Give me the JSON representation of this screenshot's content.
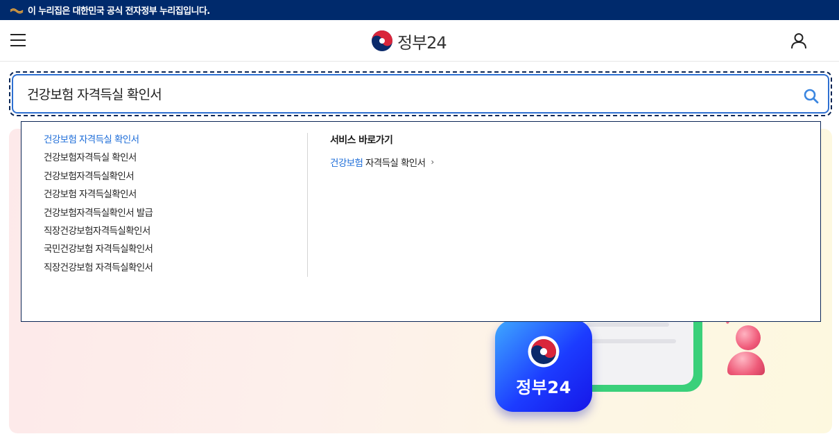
{
  "top_notice": {
    "icon": "government-emblem-icon",
    "text": "이 누리집은 대한민국 공식 전자정부 누리집입니다."
  },
  "header": {
    "logo_text": "정부24",
    "menu_icon": "hamburger-menu-icon",
    "user_icon": "user-icon"
  },
  "search": {
    "value": "건강보험 자격득실 확인서",
    "button_icon": "search-icon"
  },
  "suggestions": [
    "건강보험 자격득실 확인서",
    "건강보험자격득실 확인서",
    "건강보험자격득실확인서",
    "건강보험 자격득실확인서",
    "건강보험자격득실확인서 발급",
    "직장건강보험자격득실확인서",
    "국민건강보험 자격득실확인서",
    "직장건강보험 자격득실확인서"
  ],
  "shortcut": {
    "title": "서비스 바로가기",
    "link_highlight": "건강보험",
    "link_rest": " 자격득실 확인서"
  },
  "banner": {
    "app_label": "정부24"
  },
  "colors": {
    "brand_navy": "#002a6c",
    "accent_blue": "#1c6cd8",
    "focus_blue": "#2d6fd1"
  }
}
